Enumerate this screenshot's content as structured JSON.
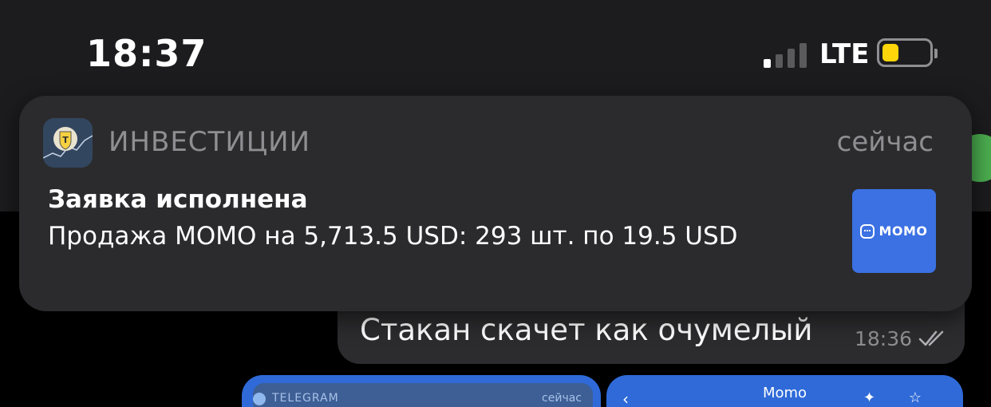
{
  "status_bar": {
    "time": "18:37",
    "network": "LTE",
    "signal_bars_active": 1,
    "signal_bars_total": 4,
    "battery_level": 0.35,
    "battery_color": "#ffd60a"
  },
  "notification": {
    "app_name": "ИНВЕСТИЦИИ",
    "time_ago": "сейчас",
    "title": "Заявка исполнена",
    "body": "Продажа MOMO на 5,713.5 USD: 293 шт. по 19.5 USD",
    "thumbnail_label": "MOMO",
    "thumbnail_color": "#3b71e3",
    "app_icon": "tinkoff-shield-icon"
  },
  "message": {
    "text": "Стакан скачет как очумелый",
    "time": "18:36",
    "status_icon": "double-check-icon"
  },
  "preview_tiles": {
    "left_app_label": "TELEGRAM",
    "left_time": "сейчас",
    "right_title": "Momo"
  }
}
